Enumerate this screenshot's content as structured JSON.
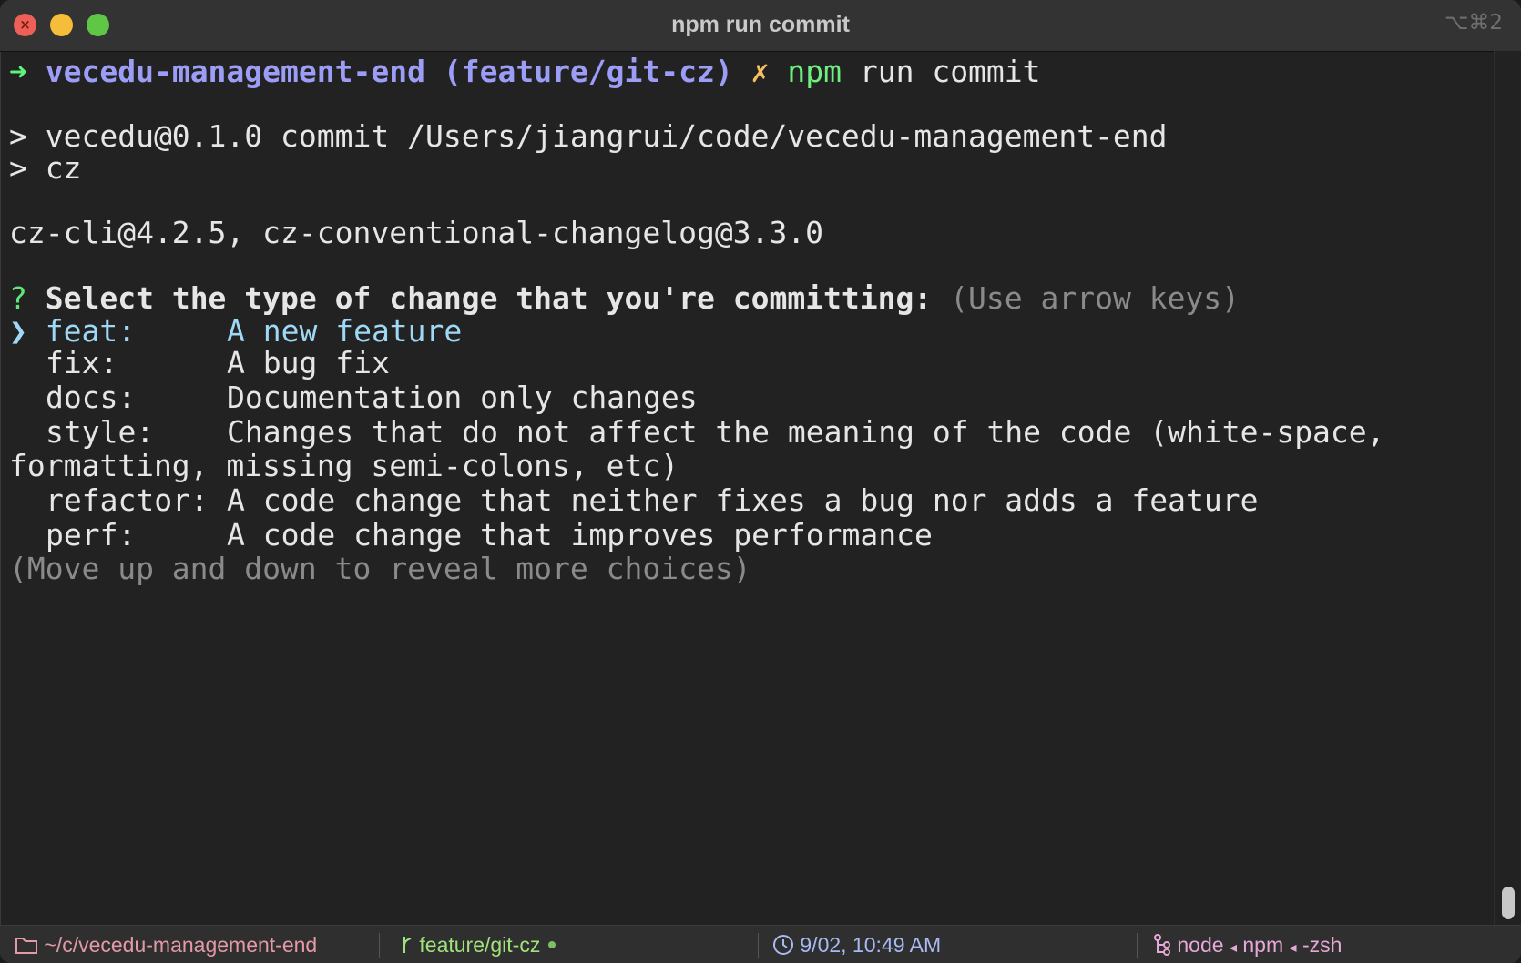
{
  "window": {
    "title": "npm run commit",
    "shortcut": "⌥⌘2"
  },
  "terminal": {
    "prompt": {
      "arrow": "➜",
      "directory": "vecedu-management-end",
      "branch": "(feature/git-cz)",
      "dirty_mark": "✗",
      "cmd_npm": "npm",
      "cmd_rest": " run commit"
    },
    "script_line_1": "> vecedu@0.1.0 commit /Users/jiangrui/code/vecedu-management-end",
    "script_line_2": "> cz",
    "version_line": "cz-cli@4.2.5, cz-conventional-changelog@3.3.0",
    "question": {
      "mark": "?",
      "text": "Select the type of change that you're committing:",
      "hint": "(Use arrow keys)"
    },
    "choices": [
      {
        "pointer": "❯",
        "key": "feat:",
        "desc": "A new feature",
        "selected": true
      },
      {
        "key": "fix:",
        "desc": "A bug fix"
      },
      {
        "key": "docs:",
        "desc": "Documentation only changes"
      },
      {
        "key": "style:",
        "desc": "Changes that do not affect the meaning of the code (white-space,",
        "desc_cont": "formatting, missing semi-colons, etc)"
      },
      {
        "key": "refactor:",
        "desc": "A code change that neither fixes a bug nor adds a feature"
      },
      {
        "key": "perf:",
        "desc": "A code change that improves performance"
      }
    ],
    "more_hint": "(Move up and down to reveal more choices)"
  },
  "statusbar": {
    "path": "~/c/vecedu-management-end",
    "branch": "feature/git-cz",
    "datetime": "9/02, 10:49 AM",
    "job_1": "node",
    "job_2": "npm",
    "job_3": "-zsh",
    "job_sep": "◂"
  },
  "colors": {
    "background": "#222222",
    "titlebar": "#333333",
    "prompt_arrow": "#5ff27b",
    "prompt_dir": "#9c9df6",
    "dirty_mark": "#f2c062",
    "selected_choice": "#9ed8f5",
    "hint_gray": "#8a8a8a",
    "status_path": "#e39aa6",
    "status_branch": "#9fe27b",
    "status_time": "#a9b9f2",
    "status_jobs": "#e6a8d6"
  }
}
